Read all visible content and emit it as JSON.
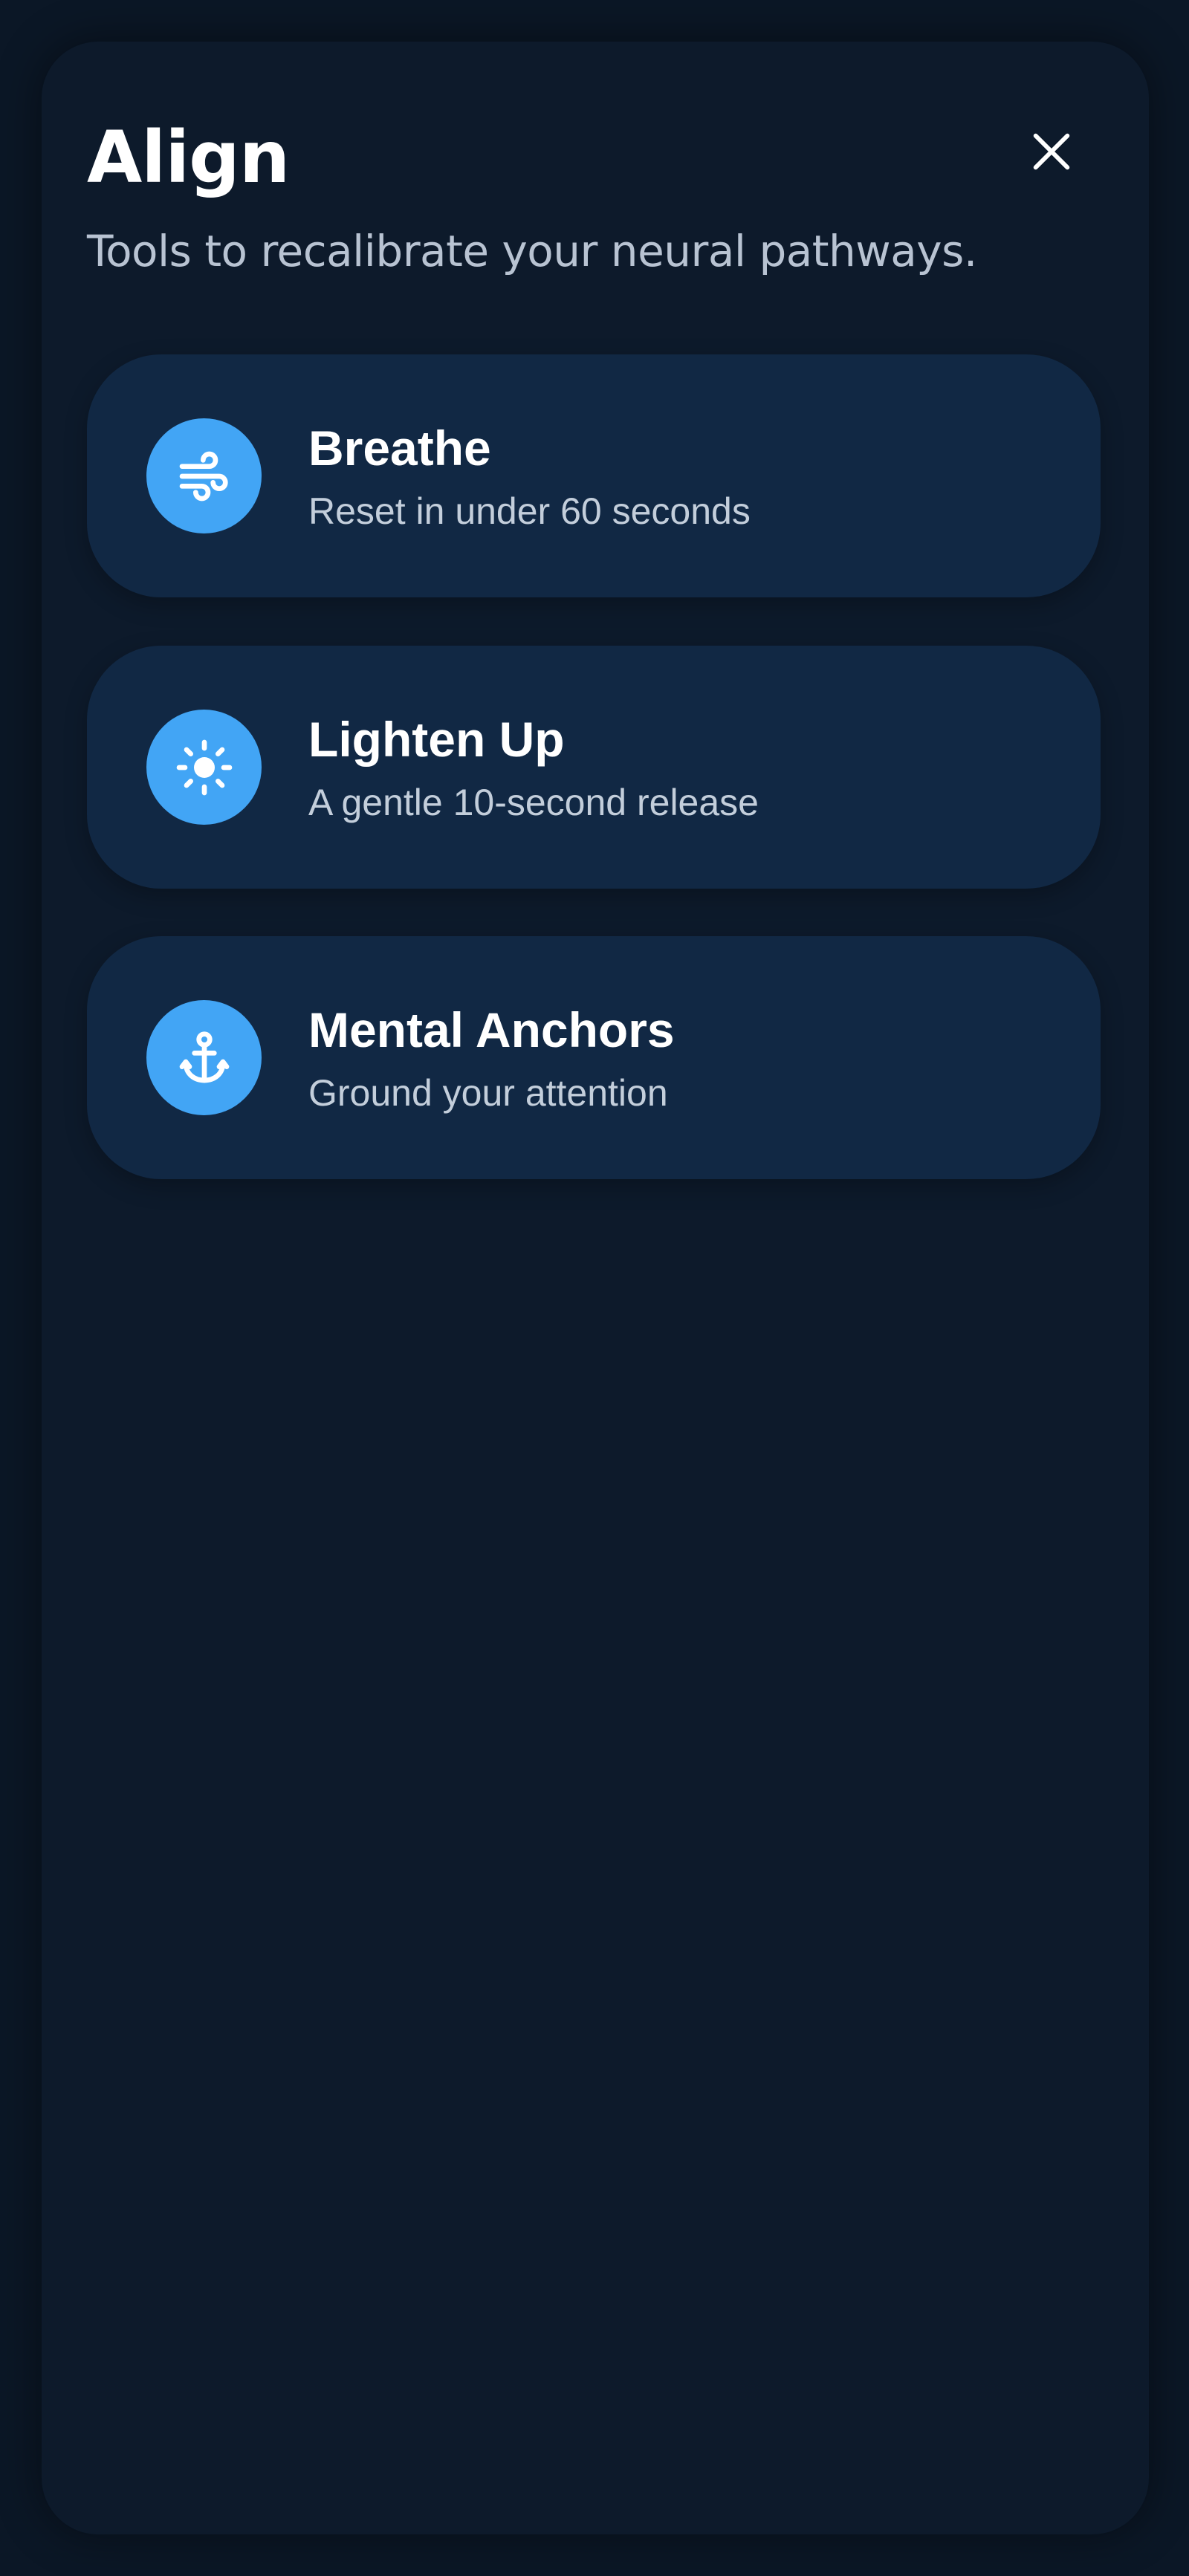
{
  "header": {
    "title": "Align",
    "subtitle": "Tools to recalibrate your neural pathways.",
    "close_icon": "close-icon"
  },
  "colors": {
    "background": "#0b1726",
    "sheet": "#0d1a2b",
    "card": "#112844",
    "accent": "#42a5f5",
    "title_text": "#ffffff",
    "subtitle_text": "#b8c3d2"
  },
  "tools": [
    {
      "title": "Breathe",
      "subtitle": "Reset in under 60 seconds",
      "icon": "wind-icon"
    },
    {
      "title": "Lighten Up",
      "subtitle": "A gentle 10-second release",
      "icon": "sun-icon"
    },
    {
      "title": "Mental Anchors",
      "subtitle": "Ground your attention",
      "icon": "anchor-icon"
    }
  ]
}
